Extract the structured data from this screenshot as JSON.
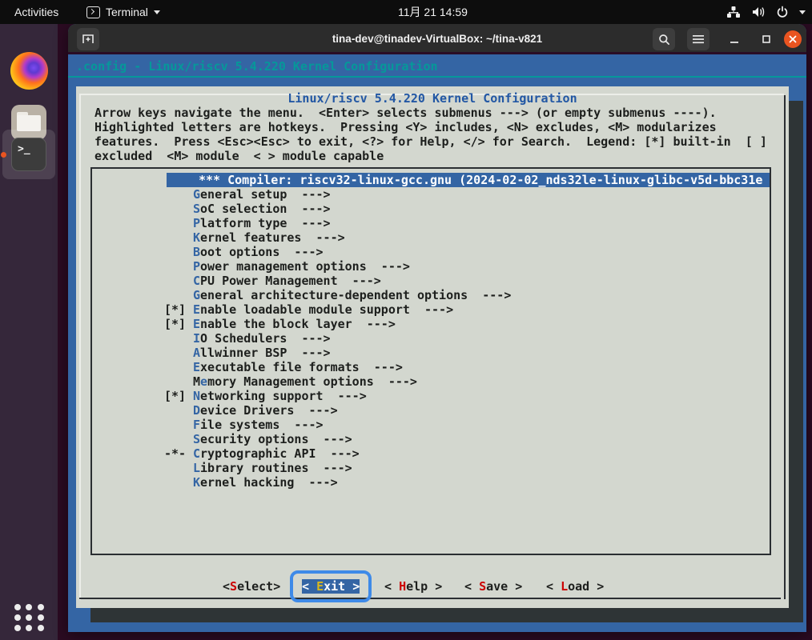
{
  "colors": {
    "screen_bg": "#3465a4",
    "dialog_bg": "#d3d7cf",
    "backtitle_teal": "#06989a",
    "dialog_title_blue": "#2257a4",
    "hotkey_blue": "#3465a4",
    "button_hotkey_red": "#cc0000",
    "focused_hotkey_yellow": "#d9b81c",
    "shadow": "#2e3436",
    "focus_ring_blue": "#3e8ae8",
    "close_button_orange": "#e95420",
    "desktop_purple": "#2b0b22"
  },
  "top_bar": {
    "activities_label": "Activities",
    "app_menu_label": "Terminal",
    "clock": "11月 21  14:59",
    "status_icons": [
      "network-icon",
      "volume-icon",
      "power-icon",
      "chevron-down-icon"
    ]
  },
  "dock": {
    "items": [
      {
        "icon": "firefox-icon"
      },
      {
        "icon": "files-icon"
      },
      {
        "icon": "terminal-icon",
        "active": true,
        "glyph": ">_"
      }
    ],
    "app_grid_icon": "show-applications-icon"
  },
  "window": {
    "title": "tina-dev@tinadev-VirtualBox: ~/tina-v821",
    "header_icons": [
      "new-tab-icon",
      "search-icon",
      "menu-icon",
      "minimize-icon",
      "maximize-icon",
      "close-icon"
    ]
  },
  "terminal": {
    "backtitle": ".config - Linux/riscv 5.4.220 Kernel Configuration",
    "dialog": {
      "title": "Linux/riscv 5.4.220 Kernel Configuration",
      "instructions": [
        "Arrow keys navigate the menu.  <Enter> selects submenus ---> (or empty submenus ----).",
        "Highlighted letters are hotkeys.  Pressing <Y> includes, <N> excludes, <M> modularizes",
        "features.  Press <Esc><Esc> to exit, <?> for Help, </> for Search.  Legend: [*] built-in  [ ]",
        "excluded  <M> module  < > module capable"
      ],
      "menu": {
        "items": [
          {
            "selected": true,
            "text": "*** Compiler: riscv32-linux-gcc.gnu (2024-02-02_nds32le-linux-glibc-v5d-bbc31e"
          },
          {
            "box": "",
            "pre": "",
            "key": "G",
            "text": "eneral setup  --->"
          },
          {
            "box": "",
            "pre": "",
            "key": "S",
            "text": "oC selection  --->"
          },
          {
            "box": "",
            "pre": "",
            "key": "P",
            "text": "latform type  --->"
          },
          {
            "box": "",
            "pre": "",
            "key": "K",
            "text": "ernel features  --->"
          },
          {
            "box": "",
            "pre": "",
            "key": "B",
            "text": "oot options  --->"
          },
          {
            "box": "",
            "pre": "",
            "key": "P",
            "text": "ower management options  --->"
          },
          {
            "box": "",
            "pre": "",
            "key": "C",
            "text": "PU Power Management  --->"
          },
          {
            "box": "",
            "pre": "",
            "key": "G",
            "text": "eneral architecture-dependent options  --->"
          },
          {
            "box": "[*]",
            "pre": "",
            "key": "E",
            "text": "nable loadable module support  --->"
          },
          {
            "box": "[*]",
            "pre": "",
            "key": "E",
            "text": "nable the block layer  --->"
          },
          {
            "box": "",
            "pre": "",
            "key": "I",
            "text": "O Schedulers  --->"
          },
          {
            "box": "",
            "pre": "",
            "key": "A",
            "text": "llwinner BSP  --->"
          },
          {
            "box": "",
            "pre": "",
            "key": "E",
            "text": "xecutable file formats  --->"
          },
          {
            "box": "",
            "pre": "M",
            "key": "e",
            "text": "mory Management options  --->"
          },
          {
            "box": "[*]",
            "pre": "",
            "key": "N",
            "text": "etworking support  --->"
          },
          {
            "box": "",
            "pre": "",
            "key": "D",
            "text": "evice Drivers  --->"
          },
          {
            "box": "",
            "pre": "",
            "key": "F",
            "text": "ile systems  --->"
          },
          {
            "box": "",
            "pre": "",
            "key": "S",
            "text": "ecurity options  --->"
          },
          {
            "box": "-*-",
            "pre": "",
            "key": "C",
            "text": "ryptographic API  --->"
          },
          {
            "box": "",
            "pre": "",
            "key": "L",
            "text": "ibrary routines  --->"
          },
          {
            "box": "",
            "pre": "",
            "key": "K",
            "text": "ernel hacking  --->"
          }
        ]
      },
      "buttons": [
        {
          "pre": "<",
          "key": "S",
          "rest": "elect>",
          "focused": false
        },
        {
          "pre": "< ",
          "key": "E",
          "rest": "xit >",
          "focused": true
        },
        {
          "pre": "< ",
          "key": "H",
          "rest": "elp >",
          "focused": false
        },
        {
          "pre": "< ",
          "key": "S",
          "rest": "ave >",
          "focused": false
        },
        {
          "pre": "< ",
          "key": "L",
          "rest": "oad >",
          "focused": false
        }
      ]
    }
  }
}
